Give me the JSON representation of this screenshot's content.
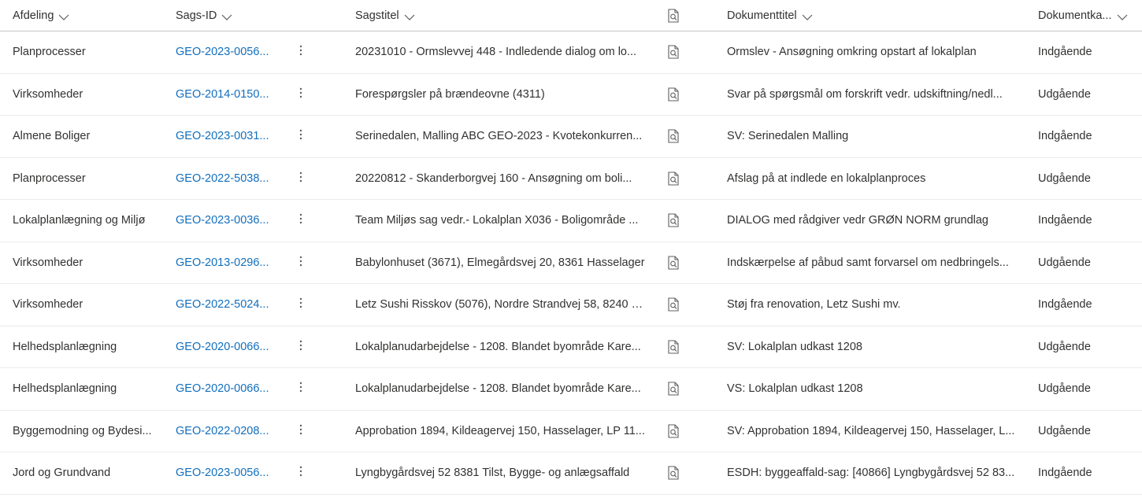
{
  "columns": {
    "afdeling": "Afdeling",
    "sags_id": "Sags-ID",
    "sagstitel": "Sagstitel",
    "dokumenttitel": "Dokumenttitel",
    "dokumentkategori": "Dokumentka..."
  },
  "icons": {
    "header_icon": "document-search-icon",
    "row_icon": "document-search-icon",
    "sort": "chevron-down-icon",
    "more": "more-vertical-icon"
  },
  "colors": {
    "link": "#106ebe",
    "text": "#323130",
    "border": "#edebe9"
  },
  "rows": [
    {
      "afdeling": "Planprocesser",
      "sags_id": "GEO-2023-0056...",
      "sagstitel": "20231010 - Ormslevvej 448 - Indledende dialog om lo...",
      "dokumenttitel": "Ormslev - Ansøgning omkring opstart af lokalplan",
      "kategori": "Indgående"
    },
    {
      "afdeling": "Virksomheder",
      "sags_id": "GEO-2014-0150...",
      "sagstitel": "Forespørgsler på brændeovne (4311)",
      "dokumenttitel": "Svar på spørgsmål om forskrift vedr. udskiftning/nedl...",
      "kategori": "Udgående"
    },
    {
      "afdeling": "Almene Boliger",
      "sags_id": "GEO-2023-0031...",
      "sagstitel": "Serinedalen, Malling ABC GEO-2023 - Kvotekonkurren...",
      "dokumenttitel": "SV: Serinedalen Malling",
      "kategori": "Indgående"
    },
    {
      "afdeling": "Planprocesser",
      "sags_id": "GEO-2022-5038...",
      "sagstitel": "20220812 - Skanderborgvej 160 - Ansøgning om boli...",
      "dokumenttitel": "Afslag på at indlede en lokalplanproces",
      "kategori": "Udgående"
    },
    {
      "afdeling": "Lokalplanlægning og Miljø",
      "sags_id": "GEO-2023-0036...",
      "sagstitel": "Team Miljøs sag vedr.- Lokalplan X036 - Boligområde ...",
      "dokumenttitel": "DIALOG med rådgiver vedr GRØN NORM grundlag",
      "kategori": "Indgående"
    },
    {
      "afdeling": "Virksomheder",
      "sags_id": "GEO-2013-0296...",
      "sagstitel": "Babylonhuset (3671), Elmegårdsvej 20, 8361 Hasselager",
      "dokumenttitel": "Indskærpelse af påbud samt forvarsel om nedbringels...",
      "kategori": "Udgående"
    },
    {
      "afdeling": "Virksomheder",
      "sags_id": "GEO-2022-5024...",
      "sagstitel": "Letz Sushi Risskov (5076), Nordre Strandvej 58, 8240 R...",
      "dokumenttitel": "Støj fra renovation, Letz Sushi mv.",
      "kategori": "Indgående"
    },
    {
      "afdeling": "Helhedsplanlægning",
      "sags_id": "GEO-2020-0066...",
      "sagstitel": "Lokalplanudarbejdelse - 1208. Blandet byområde Kare...",
      "dokumenttitel": "SV: Lokalplan udkast 1208",
      "kategori": "Udgående"
    },
    {
      "afdeling": "Helhedsplanlægning",
      "sags_id": "GEO-2020-0066...",
      "sagstitel": "Lokalplanudarbejdelse - 1208. Blandet byområde Kare...",
      "dokumenttitel": "VS: Lokalplan udkast 1208",
      "kategori": "Udgående"
    },
    {
      "afdeling": "Byggemodning og Bydesi...",
      "sags_id": "GEO-2022-0208...",
      "sagstitel": "Approbation 1894, Kildeagervej 150, Hasselager, LP 11...",
      "dokumenttitel": "SV: Approbation 1894, Kildeagervej 150, Hasselager, L...",
      "kategori": "Udgående"
    },
    {
      "afdeling": "Jord og Grundvand",
      "sags_id": "GEO-2023-0056...",
      "sagstitel": "Lyngbygårdsvej 52 8381 Tilst, Bygge- og anlægsaffald",
      "dokumenttitel": "ESDH: byggeaffald-sag: [40866] Lyngbygårdsvej 52 83...",
      "kategori": "Indgående"
    }
  ]
}
